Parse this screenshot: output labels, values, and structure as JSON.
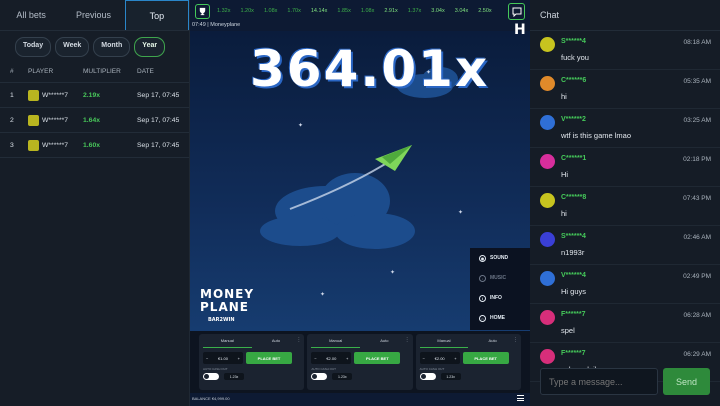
{
  "left": {
    "tabs": [
      "All bets",
      "Previous",
      "Top"
    ],
    "periods": [
      "Today",
      "Week",
      "Month",
      "Year"
    ],
    "headers": [
      "#",
      "PLAYER",
      "MULTIPLIER",
      "DATE"
    ],
    "rows": [
      {
        "rank": "1",
        "player": "W******7",
        "mult": "2.19x",
        "date": "Sep 17, 07:45"
      },
      {
        "rank": "2",
        "player": "W******7",
        "mult": "1.64x",
        "date": "Sep 17, 07:45"
      },
      {
        "rank": "3",
        "player": "W******7",
        "mult": "1.60x",
        "date": "Sep 17, 07:45"
      }
    ]
  },
  "game": {
    "history": [
      "1.32x",
      "1.20x",
      "1.08x",
      "1.70x",
      "14.14x",
      "1.85x",
      "1.08x",
      "2.91x",
      "1.37x",
      "3.04x",
      "3.04x",
      "2.50x"
    ],
    "time": "07:49",
    "name": "Moneyplane",
    "multiplier": "364.01x",
    "menu": [
      "SOUND",
      "MUSIC",
      "INFO",
      "HOME"
    ],
    "brand1": "MONEY",
    "brand2": "PLANE",
    "brand3": "BAR2WIN",
    "bet": {
      "tab_manual": "Manual",
      "tab_auto": "Auto",
      "amounts": [
        "€1.00",
        "€2.00",
        "€2.00"
      ],
      "place": "PLACE BET",
      "auto_label": "AUTO CASH OUT",
      "cashouts": [
        "1.23x",
        "1.23x",
        "1.23x"
      ]
    },
    "balance_label": "BALANCE",
    "balance": "€4,999.00"
  },
  "chat": {
    "title": "Chat",
    "messages": [
      {
        "name": "S******4",
        "time": "08:18 AM",
        "text": "fuck you",
        "color": "#c7c41f"
      },
      {
        "name": "C******6",
        "time": "05:35 AM",
        "text": "hi",
        "color": "#e08a2a"
      },
      {
        "name": "V******2",
        "time": "03:25 AM",
        "text": "wtf is this game lmao",
        "color": "#2f6fd6"
      },
      {
        "name": "C******1",
        "time": "02:18 PM",
        "text": "Hi",
        "color": "#d72e9c"
      },
      {
        "name": "C******8",
        "time": "07:43 PM",
        "text": "hi",
        "color": "#c7c41f"
      },
      {
        "name": "S******4",
        "time": "02:46 AM",
        "text": "n1993r",
        "color": "#3a3fd6"
      },
      {
        "name": "V******4",
        "time": "02:49 PM",
        "text": "Hi guys",
        "color": "#2f6fd6"
      },
      {
        "name": "F******7",
        "time": "06:28 AM",
        "text": "spel",
        "color": "#d72e7a"
      },
      {
        "name": "F******7",
        "time": "06:29 AM",
        "text": "salem aleikum",
        "color": "#d72e7a"
      }
    ],
    "placeholder": "Type a message...",
    "send": "Send"
  }
}
